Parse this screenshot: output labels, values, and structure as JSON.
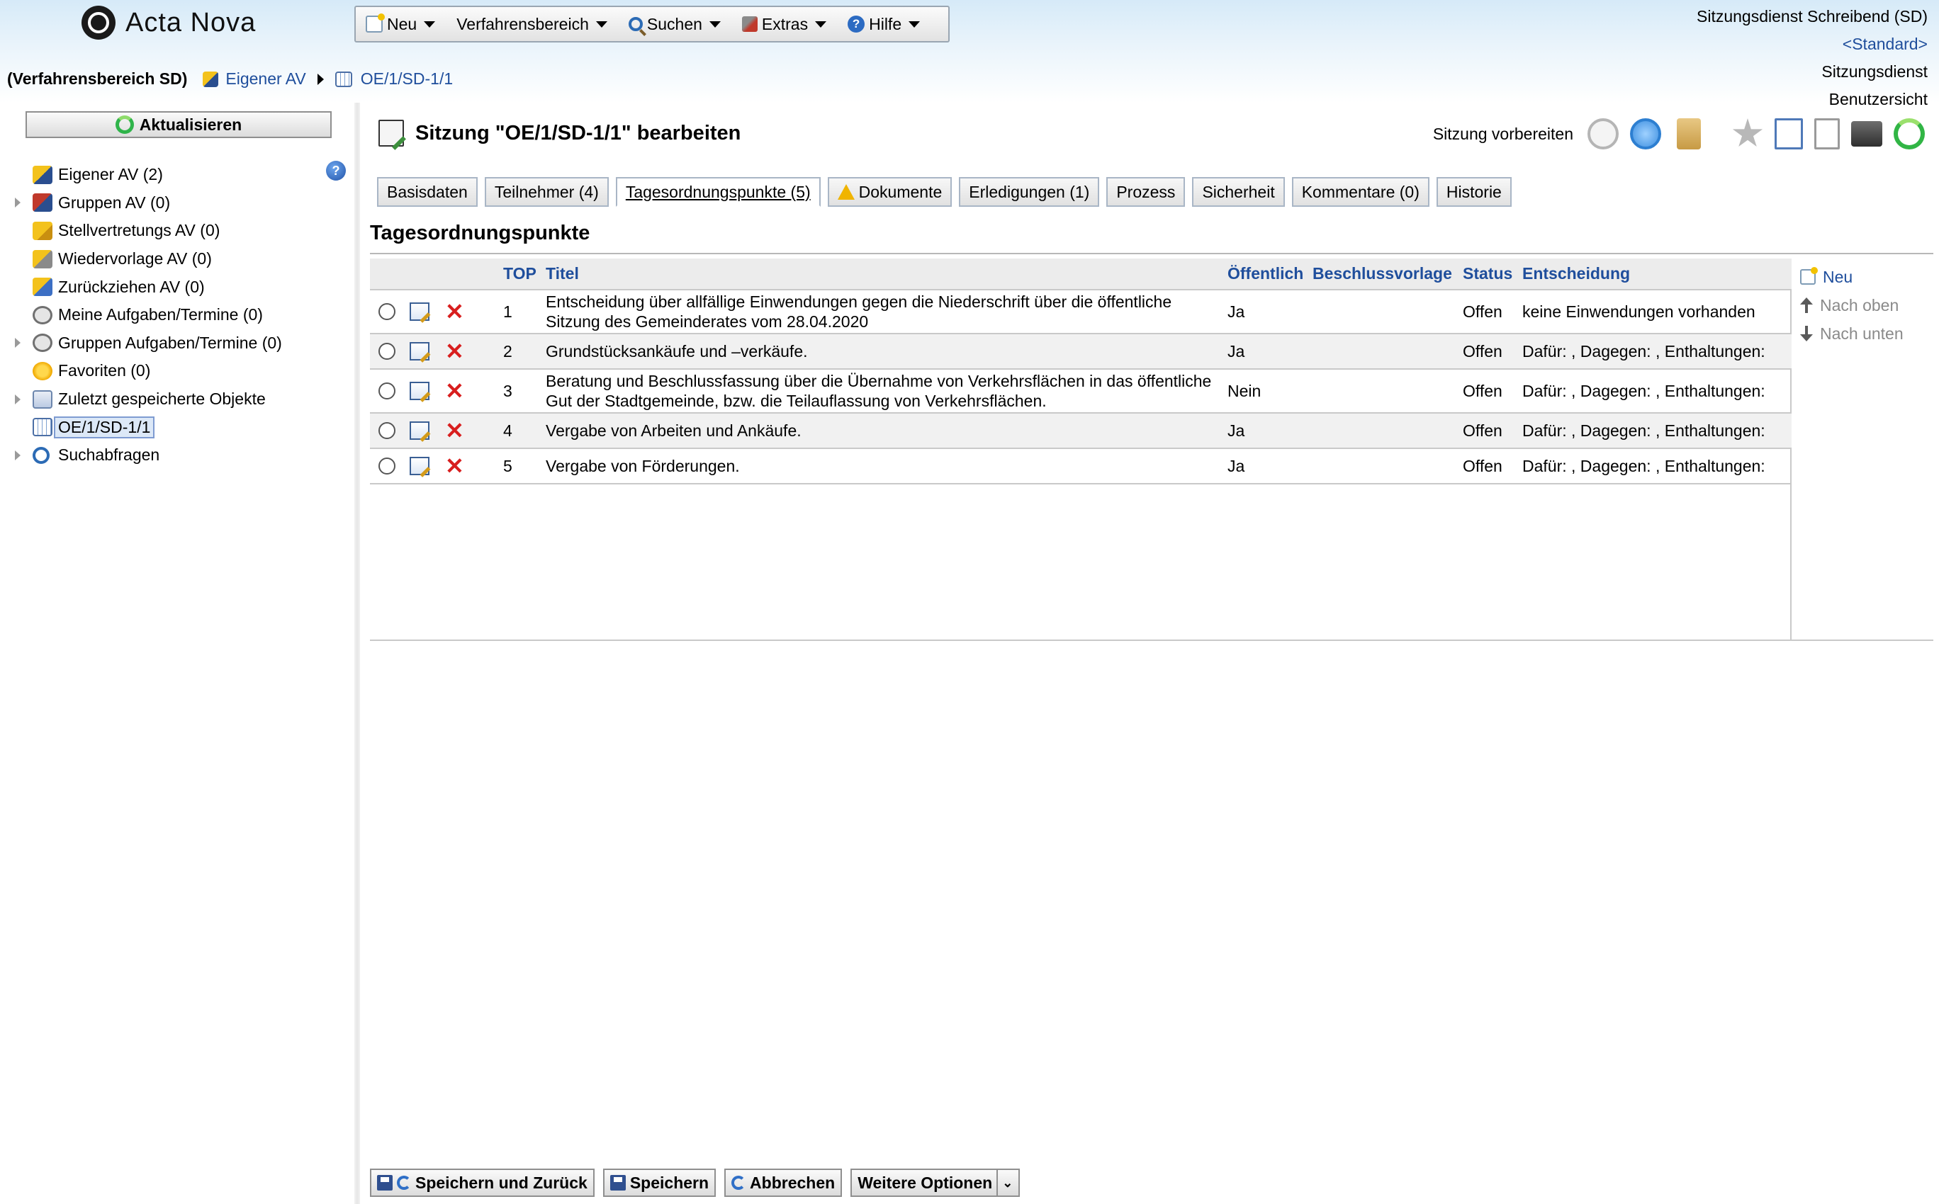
{
  "app": {
    "name": "Acta Nova"
  },
  "menu": [
    {
      "label": "Neu",
      "icon": "new-document-icon"
    },
    {
      "label": "Verfahrensbereich",
      "icon": ""
    },
    {
      "label": "Suchen",
      "icon": "search-icon"
    },
    {
      "label": "Extras",
      "icon": "tools-icon"
    },
    {
      "label": "Hilfe",
      "icon": "help-icon"
    }
  ],
  "user": {
    "line1": "Sitzungsdienst Schreibend (SD)",
    "line2": "<Standard>",
    "line3": "Sitzungsdienst",
    "line4": "Benutzersicht"
  },
  "breadcrumb": {
    "area": "(Verfahrensbereich SD)",
    "item1": "Eigener AV",
    "item2": "OE/1/SD-1/1"
  },
  "sidebar": {
    "refresh_label": "Aktualisieren",
    "help_symbol": "?",
    "items": [
      {
        "label": "Eigener AV (2)",
        "icon": "inbox-icon",
        "expandable": false
      },
      {
        "label": "Gruppen AV (0)",
        "icon": "group-inbox-icon",
        "expandable": true
      },
      {
        "label": "Stellvertretungs AV (0)",
        "icon": "deputy-inbox-icon",
        "expandable": false
      },
      {
        "label": "Wiedervorlage AV (0)",
        "icon": "resubmission-icon",
        "expandable": false
      },
      {
        "label": "Zurückziehen AV (0)",
        "icon": "recall-icon",
        "expandable": false
      },
      {
        "label": "Meine Aufgaben/Termine (0)",
        "icon": "task-clock-icon",
        "expandable": false
      },
      {
        "label": "Gruppen Aufgaben/Termine (0)",
        "icon": "group-task-clock-icon",
        "expandable": true
      },
      {
        "label": "Favoriten (0)",
        "icon": "star-icon",
        "expandable": false
      },
      {
        "label": "Zuletzt gespeicherte Objekte",
        "icon": "saved-objects-icon",
        "expandable": true
      },
      {
        "label": "OE/1/SD-1/1",
        "icon": "calendar-icon",
        "expandable": false,
        "selected": true
      },
      {
        "label": "Suchabfragen",
        "icon": "search-query-icon",
        "expandable": true
      }
    ]
  },
  "main": {
    "title": "Sitzung \"OE/1/SD-1/1\" bearbeiten",
    "action_label": "Sitzung vorbereiten",
    "tabs": [
      {
        "label": "Basisdaten"
      },
      {
        "label": "Teilnehmer (4)"
      },
      {
        "label": "Tagesordnungspunkte (5)",
        "active": true
      },
      {
        "label": "Dokumente",
        "warning": true
      },
      {
        "label": "Erledigungen (1)"
      },
      {
        "label": "Prozess"
      },
      {
        "label": "Sicherheit"
      },
      {
        "label": "Kommentare (0)"
      },
      {
        "label": "Historie"
      }
    ],
    "section_title": "Tagesordnungspunkte",
    "columns": [
      "TOP",
      "Titel",
      "Öffentlich",
      "Beschlussvorlage",
      "Status",
      "Entscheidung"
    ],
    "rows": [
      {
        "top": "1",
        "title": "Entscheidung über allfällige Einwendungen gegen die Niederschrift über die öffentliche Sitzung des Gemeinderates vom 28.04.2020",
        "public": "Ja",
        "proposal": "",
        "status": "Offen",
        "decision": "keine Einwendungen vorhanden"
      },
      {
        "top": "2",
        "title": "Grundstücksankäufe und –verkäufe.",
        "public": "Ja",
        "proposal": "",
        "status": "Offen",
        "decision": "Dafür: , Dagegen: , Enthaltungen:"
      },
      {
        "top": "3",
        "title": "Beratung und Beschlussfassung über die Übernahme von Verkehrsflächen in das öffentliche Gut der Stadtgemeinde, bzw. die Teilauflassung von Verkehrsflächen.",
        "public": "Nein",
        "proposal": "",
        "status": "Offen",
        "decision": "Dafür: , Dagegen: , Enthaltungen:"
      },
      {
        "top": "4",
        "title": "Vergabe von Arbeiten und Ankäufe.",
        "public": "Ja",
        "proposal": "",
        "status": "Offen",
        "decision": "Dafür: , Dagegen: , Enthaltungen:"
      },
      {
        "top": "5",
        "title": "Vergabe von Förderungen.",
        "public": "Ja",
        "proposal": "",
        "status": "Offen",
        "decision": "Dafür: , Dagegen: , Enthaltungen:"
      }
    ],
    "side_actions": [
      {
        "label": "Neu",
        "enabled": true
      },
      {
        "label": "Nach oben",
        "enabled": false
      },
      {
        "label": "Nach unten",
        "enabled": false
      }
    ]
  },
  "footer": {
    "save_back": "Speichern und Zurück",
    "save": "Speichern",
    "cancel": "Abbrechen",
    "more": "Weitere Optionen"
  },
  "colors": {
    "link": "#1f4e9c",
    "header_top": "#d6eaf8",
    "delete": "#d81e1e"
  }
}
